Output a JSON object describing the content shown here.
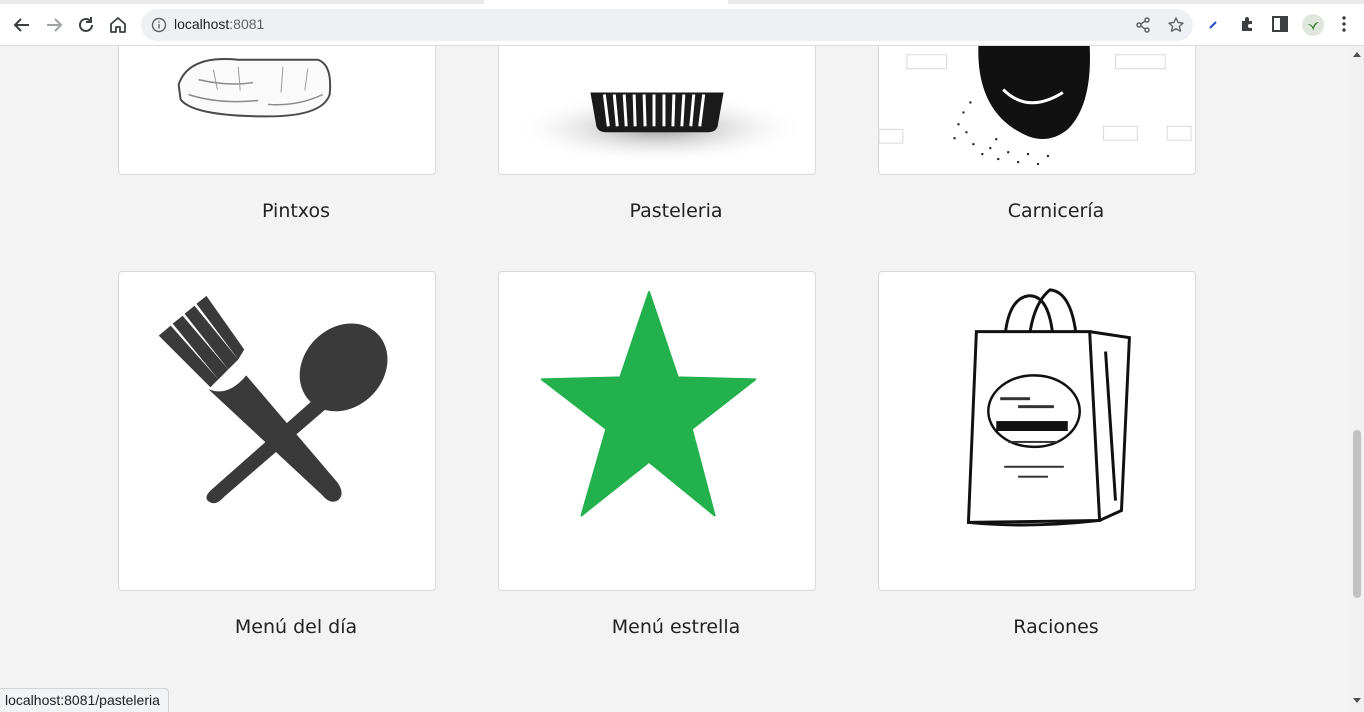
{
  "browser": {
    "url_host": "localhost",
    "url_port": ":8081",
    "status_text": "localhost:8081/pasteleria"
  },
  "categories_top": [
    {
      "title": "Pintxos",
      "image": "pintxos-image"
    },
    {
      "title": "Pasteleria",
      "image": "cupcake-image"
    },
    {
      "title": "Carnicería",
      "image": "butcher-image"
    }
  ],
  "categories_bottom": [
    {
      "title": "Menú del día",
      "image": "fork-spoon-image"
    },
    {
      "title": "Menú estrella",
      "image": "green-star-image"
    },
    {
      "title": "Raciones",
      "image": "shopping-bag-image"
    }
  ],
  "colors": {
    "star": "#22b14c",
    "cutlery": "#3a3a3a",
    "page_bg": "#f3f3f3"
  }
}
